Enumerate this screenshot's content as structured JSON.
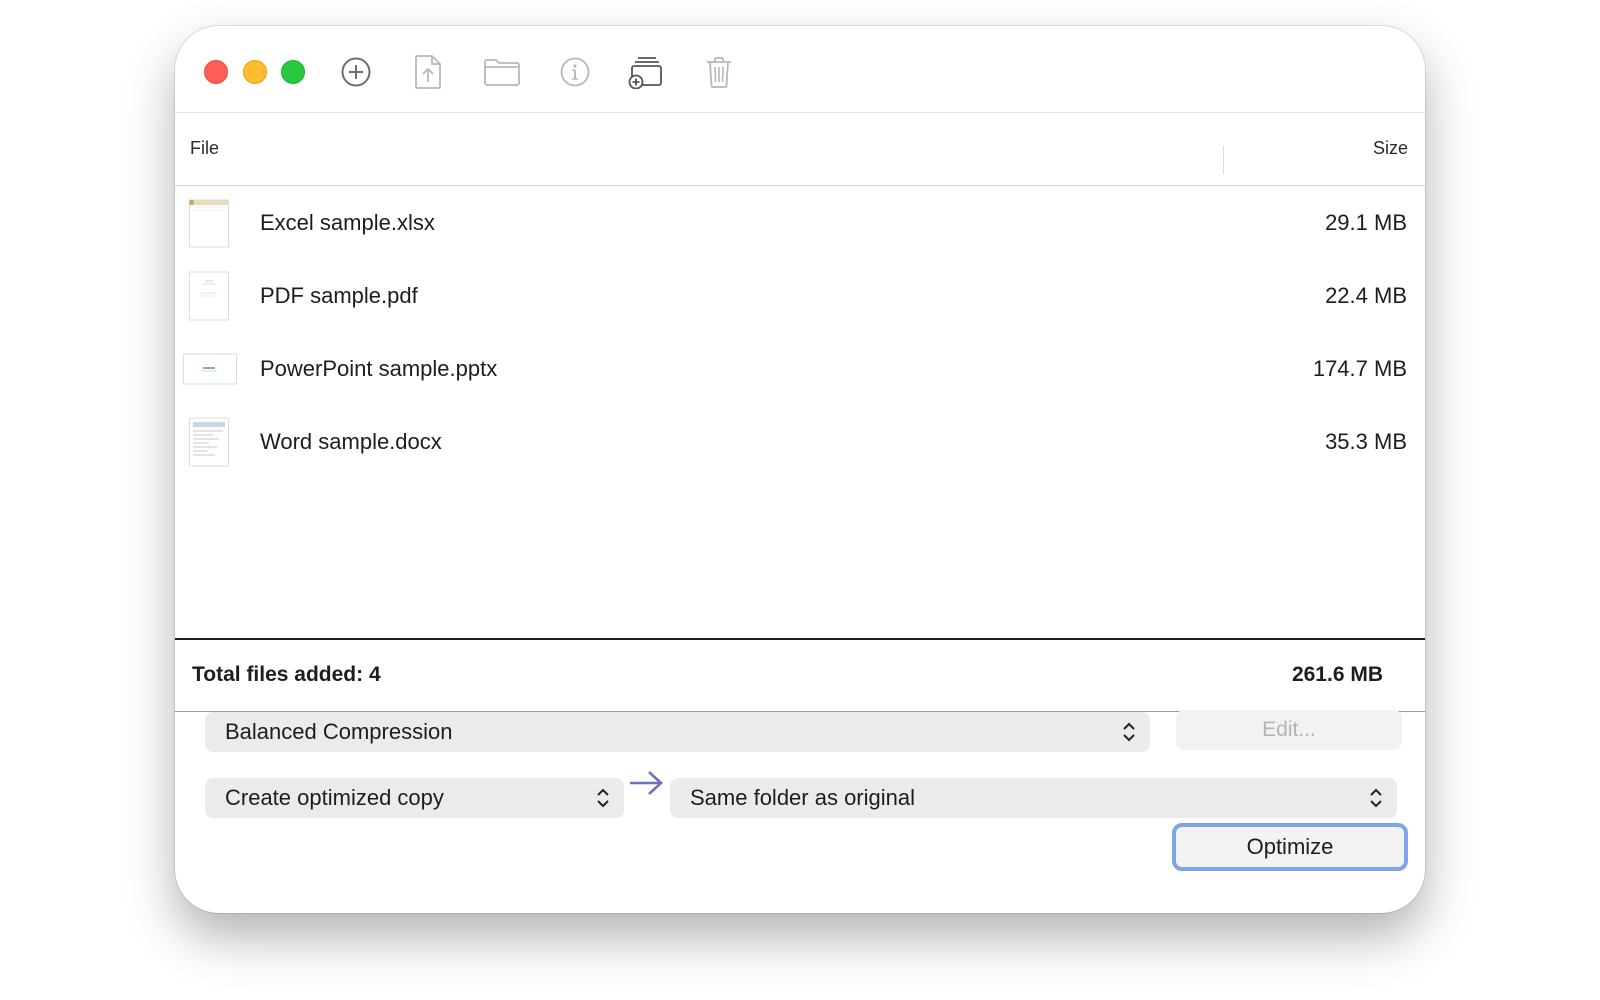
{
  "toolbar": {
    "buttons": [
      {
        "name": "add",
        "icon": "plus-circle-icon"
      },
      {
        "name": "export",
        "icon": "document-upload-icon"
      },
      {
        "name": "folder",
        "icon": "folder-icon"
      },
      {
        "name": "info",
        "icon": "info-circle-icon"
      },
      {
        "name": "add-to-stack",
        "icon": "stack-add-icon"
      },
      {
        "name": "delete",
        "icon": "trash-icon"
      }
    ]
  },
  "list": {
    "header_file": "File",
    "header_size": "Size",
    "files": [
      {
        "name": "Excel sample.xlsx",
        "size": "29.1 MB",
        "thumb": "excel-thumbnail"
      },
      {
        "name": "PDF sample.pdf",
        "size": "22.4 MB",
        "thumb": "pdf-thumbnail"
      },
      {
        "name": "PowerPoint sample.pptx",
        "size": "174.7 MB",
        "thumb": "powerpoint-thumbnail"
      },
      {
        "name": "Word sample.docx",
        "size": "35.3 MB",
        "thumb": "word-thumbnail"
      }
    ]
  },
  "summary": {
    "total_label": "Total files added: 4",
    "total_size": "261.6 MB"
  },
  "controls": {
    "compression_preset": "Balanced Compression",
    "edit_label": "Edit...",
    "output_mode": "Create optimized copy",
    "destination": "Same folder as original",
    "optimize_label": "Optimize"
  },
  "colors": {
    "close": "#fe5f57",
    "minimize": "#febc2e",
    "zoom": "#28c840",
    "focus_ring": "#7fa4ea",
    "arrow": "#6b74b8"
  }
}
